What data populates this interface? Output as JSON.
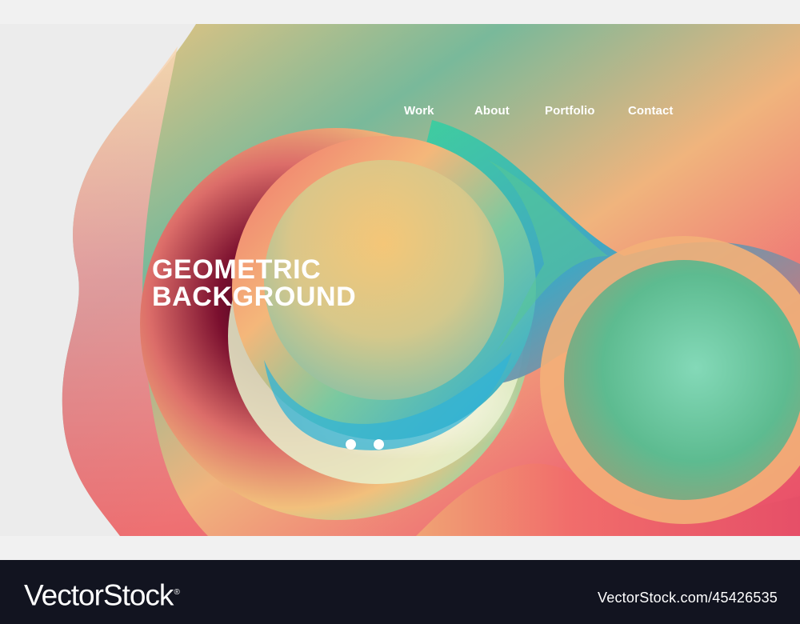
{
  "nav": {
    "items": [
      {
        "label": "Work"
      },
      {
        "label": "About"
      },
      {
        "label": "Portfolio"
      },
      {
        "label": "Contact"
      }
    ]
  },
  "hero": {
    "title_line1": "GEOMETRIC",
    "title_line2": "BACKGROUND",
    "slider": {
      "dot_count": 2
    }
  },
  "footer": {
    "brand": "VectorStock",
    "brand_mark": "®",
    "stock_id": "VectorStock.com/45426535"
  },
  "colors": {
    "text_on_hero": "#ffffff",
    "footer_bg": "#121420",
    "page_bg": "#f1f1f1"
  }
}
